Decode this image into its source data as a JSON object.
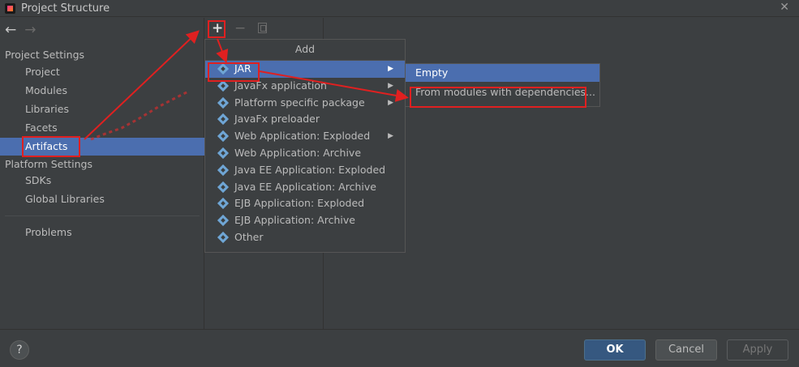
{
  "window": {
    "title": "Project Structure",
    "close_glyph": "✕"
  },
  "nav": {
    "back_glyph": "←",
    "forward_glyph": "→"
  },
  "sidebar": {
    "project_settings_label": "Project Settings",
    "project_settings_items": [
      "Project",
      "Modules",
      "Libraries",
      "Facets",
      "Artifacts"
    ],
    "platform_settings_label": "Platform Settings",
    "platform_settings_items": [
      "SDKs",
      "Global Libraries"
    ],
    "problems_label": "Problems",
    "selected_item": "Artifacts"
  },
  "toolbar": {
    "add_glyph": "+",
    "remove_glyph": "−",
    "copy_icon": "copy-icon"
  },
  "add_menu": {
    "header": "Add",
    "items": [
      "JAR",
      "JavaFx application",
      "Platform specific package",
      "JavaFx preloader",
      "Web Application: Exploded",
      "Web Application: Archive",
      "Java EE Application: Exploded",
      "Java EE Application: Archive",
      "EJB Application: Exploded",
      "EJB Application: Archive",
      "Other"
    ],
    "submenu_arrow": "▶",
    "highlighted": "JAR"
  },
  "jar_submenu": {
    "items": [
      "Empty",
      "From modules with dependencies..."
    ],
    "highlighted": "Empty"
  },
  "footer": {
    "help_glyph": "?",
    "ok_label": "OK",
    "cancel_label": "Cancel",
    "apply_label": "Apply"
  },
  "colors": {
    "selection": "#4b6eaf",
    "annotation": "#e02020",
    "background": "#3c3f41"
  }
}
